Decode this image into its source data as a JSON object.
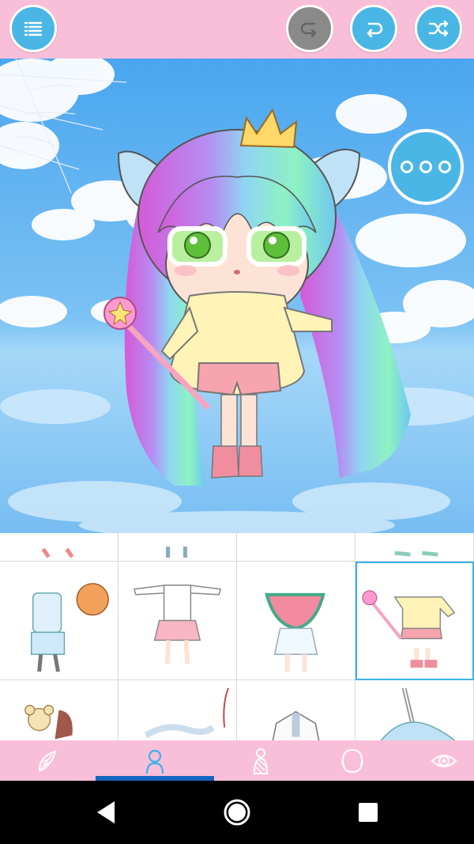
{
  "toolbar": {
    "menu_icon": "list-icon",
    "redo_icon": "redo-arrow-icon",
    "undo_icon": "undo-arrow-icon",
    "random_icon": "shuffle-icon",
    "redo_state": "disabled"
  },
  "scene": {
    "more_icon": "ellipsis-icon",
    "character": "chibi-girl-rainbow-hair"
  },
  "item_grid": {
    "selected_index": 7,
    "items": [
      "outfit-partial-1",
      "outfit-partial-2",
      "outfit-partial-3",
      "outfit-partial-4",
      "basketball-outfit",
      "pink-dress-outfit",
      "watermelon-dress",
      "wand-yellow-shirt-outfit",
      "teddy-bear-outfit",
      "ribbon-outfit",
      "white-coat-outfit",
      "blue-ribbon-outfit"
    ]
  },
  "tabs": [
    {
      "icon": "hair-leaf-icon",
      "active": false
    },
    {
      "icon": "body-icon",
      "active": true
    },
    {
      "icon": "outfit-icon",
      "active": false
    },
    {
      "icon": "face-icon",
      "active": false
    },
    {
      "icon": "eye-icon",
      "active": false
    }
  ],
  "colors": {
    "bar_pink": "#f9bfd9",
    "button_blue": "#49b6e6",
    "selection_blue": "#3ab2e8",
    "tab_indicator": "#1565c0"
  },
  "system_nav": [
    "back-icon",
    "home-icon",
    "recents-icon"
  ]
}
